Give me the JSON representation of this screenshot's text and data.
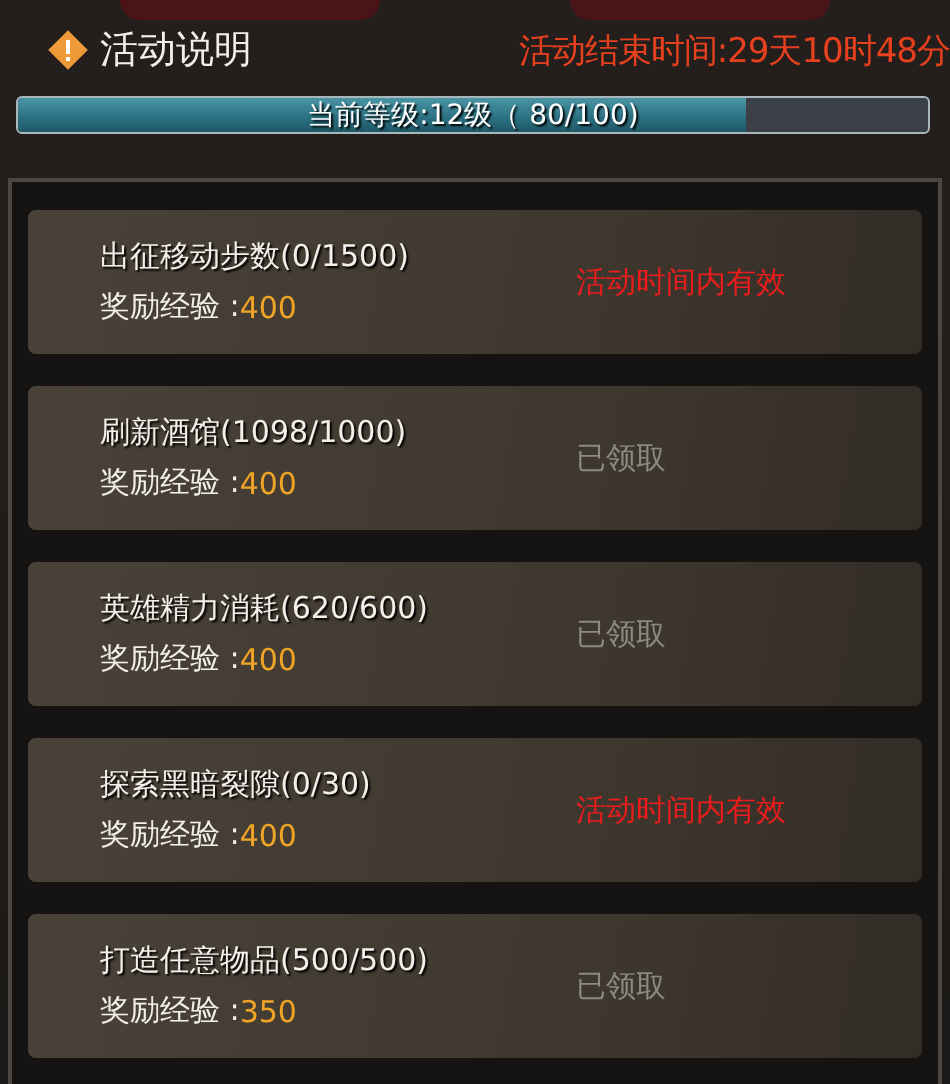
{
  "header": {
    "title": "活动说明",
    "end_time": "活动结束时间:29天10时48分"
  },
  "level_bar": {
    "label": "当前等级:12级（ 80/100)",
    "level": 0.8
  },
  "tasks": [
    {
      "name": "出征移动步数(0/1500)",
      "reward_label": "奖励经验 :",
      "reward": "400",
      "status": "活动时间内有效",
      "kind": "active"
    },
    {
      "name": "刷新酒馆(1098/1000)",
      "reward_label": "奖励经验 :",
      "reward": "400",
      "status": "已领取",
      "kind": "claimed"
    },
    {
      "name": "英雄精力消耗(620/600)",
      "reward_label": "奖励经验 :",
      "reward": "400",
      "status": "已领取",
      "kind": "claimed"
    },
    {
      "name": "探索黑暗裂隙(0/30)",
      "reward_label": "奖励经验 :",
      "reward": "400",
      "status": "活动时间内有效",
      "kind": "active"
    },
    {
      "name": "打造任意物品(500/500)",
      "reward_label": "奖励经验 :",
      "reward": "350",
      "status": "已领取",
      "kind": "claimed"
    }
  ]
}
